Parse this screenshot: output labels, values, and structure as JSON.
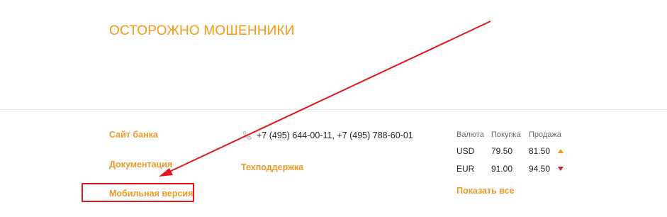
{
  "banner": {
    "title": "ОСТОРОЖНО МОШЕННИКИ"
  },
  "footer": {
    "links": {
      "site": "Сайт банка",
      "docs": "Документация",
      "mobile": "Мобильная версия",
      "support": "Техподдержка"
    },
    "phones": "+7 (495) 644-00-11, +7 (495) 788-60-01",
    "phone_icon": "phone-icon"
  },
  "rates": {
    "headers": {
      "currency": "Валюта",
      "buy": "Покупка",
      "sell": "Продажа"
    },
    "rows": [
      {
        "currency": "USD",
        "buy": "79.50",
        "sell": "81.50",
        "trend": "up"
      },
      {
        "currency": "EUR",
        "buy": "91.00",
        "sell": "94.50",
        "trend": "down"
      }
    ],
    "show_all": "Показать все"
  },
  "annotation": {
    "arrow_color": "#e3161b",
    "box_color": "#e3161b"
  },
  "colors": {
    "accent": "#f39a12",
    "link": "#e99b2b",
    "up": "#f39a12",
    "down": "#e3161b"
  }
}
